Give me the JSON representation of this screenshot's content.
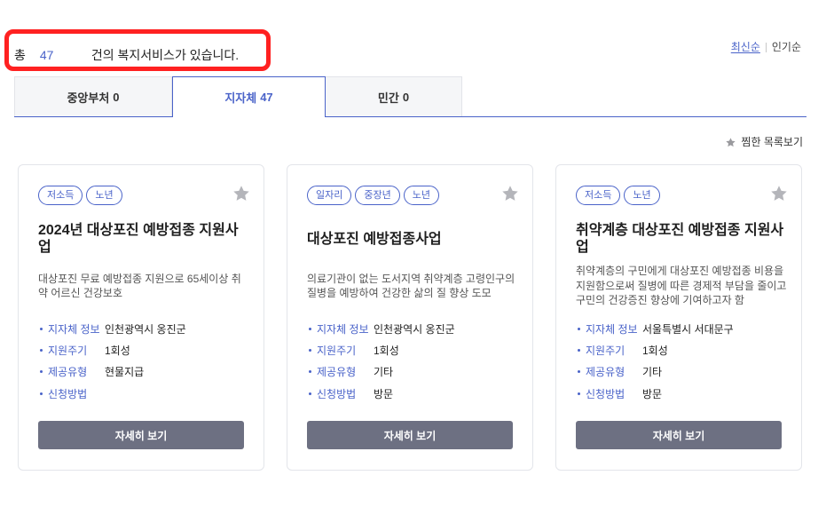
{
  "colors": {
    "accent": "#4a63c9",
    "highlight": "#ff2121",
    "button": "#6d7082"
  },
  "summary": {
    "prefix": "총",
    "count": 47,
    "suffix": "건의 복지서비스가 있습니다."
  },
  "sort": {
    "options": [
      {
        "label": "최신순",
        "active": true
      },
      {
        "label": "인기순",
        "active": false
      }
    ]
  },
  "tabs": [
    {
      "name": "중앙부처",
      "count": 0,
      "active": false
    },
    {
      "name": "지자체",
      "count": 47,
      "active": true
    },
    {
      "name": "민간",
      "count": 0,
      "active": false
    }
  ],
  "favorites_link": {
    "icon": "star-icon",
    "label": "찜한 목록보기"
  },
  "cards": [
    {
      "tags": [
        "저소득",
        "노년"
      ],
      "favorite_icon": "star-icon",
      "title": "2024년 대상포진 예방접종 지원사업",
      "description": "대상포진 무료 예방접종 지원으로 65세이상 취약 어르신 건강보호",
      "info": [
        {
          "label": "지자체 정보",
          "value": "인천광역시 옹진군"
        },
        {
          "label": "지원주기",
          "value": "1회성"
        },
        {
          "label": "제공유형",
          "value": "현물지급"
        },
        {
          "label": "신청방법"
        }
      ],
      "button_label": "자세히 보기"
    },
    {
      "tags": [
        "일자리",
        "중장년",
        "노년"
      ],
      "favorite_icon": "star-icon",
      "title": "대상포진 예방접종사업",
      "description": "의료기관이 없는 도서지역 취약계층 고령인구의 질병을 예방하여 건강한 삶의 질 향상 도모",
      "info": [
        {
          "label": "지자체 정보",
          "value": "인천광역시 옹진군"
        },
        {
          "label": "지원주기",
          "value": "1회성"
        },
        {
          "label": "제공유형",
          "value": "기타"
        },
        {
          "label": "신청방법",
          "value": "방문"
        }
      ],
      "button_label": "자세히 보기"
    },
    {
      "tags": [
        "저소득",
        "노년"
      ],
      "favorite_icon": "star-icon",
      "title": "취약계층 대상포진 예방접종 지원사업",
      "description": "취약계층의 구민에게 대상포진 예방접종 비용을 지원함으로써 질병에 따른 경제적 부담을 줄이고 구민의 건강증진 향상에 기여하고자 함",
      "info": [
        {
          "label": "지자체 정보",
          "value": "서울특별시 서대문구"
        },
        {
          "label": "지원주기",
          "value": "1회성"
        },
        {
          "label": "제공유형",
          "value": "기타"
        },
        {
          "label": "신청방법",
          "value": "방문"
        }
      ],
      "button_label": "자세히 보기"
    }
  ]
}
